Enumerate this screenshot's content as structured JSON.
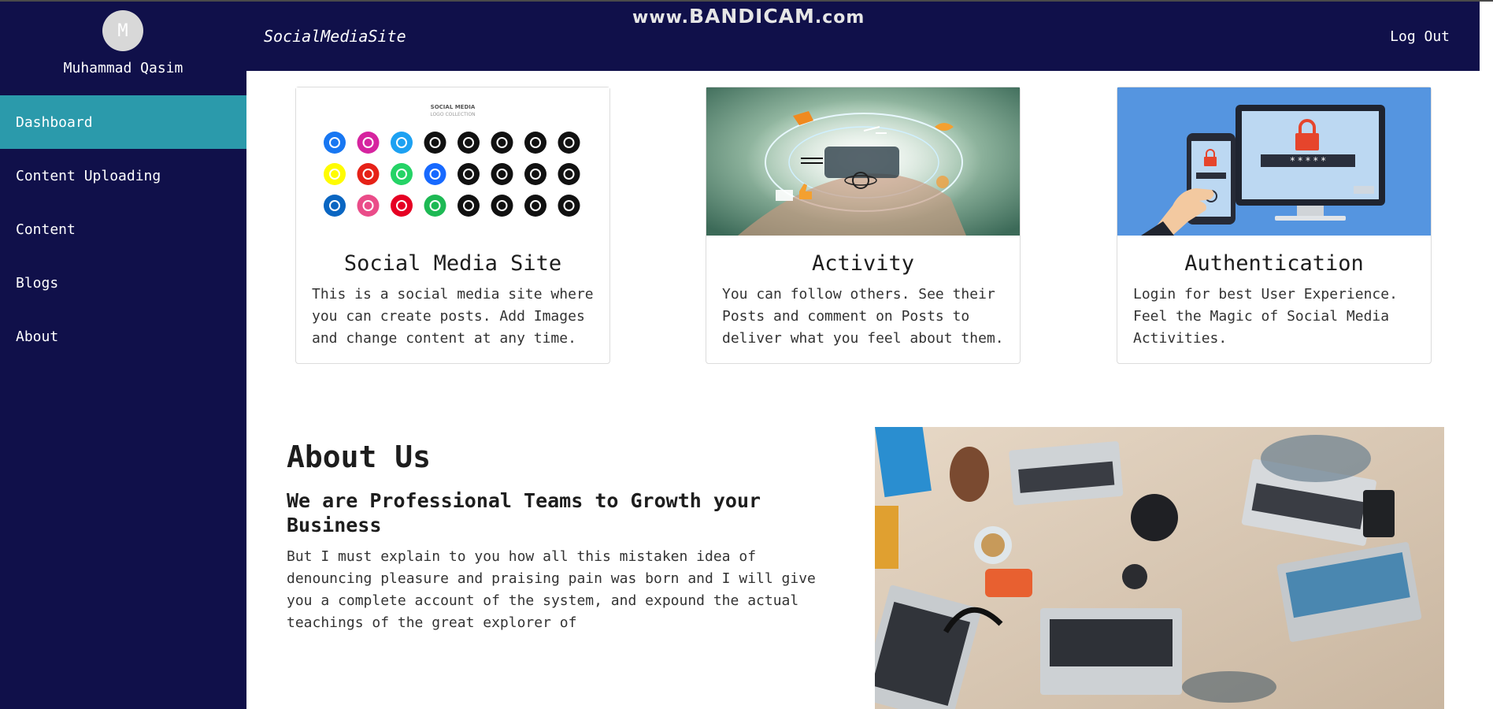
{
  "sidebar": {
    "avatar_initial": "M",
    "username": "Muhammad Qasim",
    "items": [
      {
        "label": "Dashboard",
        "active": true
      },
      {
        "label": "Content Uploading"
      },
      {
        "label": "Content"
      },
      {
        "label": "Blogs"
      },
      {
        "label": "About"
      }
    ]
  },
  "header": {
    "brand": "SocialMediaSite",
    "logout": "Log Out",
    "watermark_prefix": "www.",
    "watermark_main": "BANDICAM",
    "watermark_suffix": ".com"
  },
  "cards": [
    {
      "title": "Social Media Site",
      "text": "This is a social media site where you can create posts. Add Images and change content at any time.",
      "logo_heading": "SOCIAL MEDIA",
      "logo_subheading": "LOGO COLLECTION"
    },
    {
      "title": "Activity",
      "text": "You can follow others. See their Posts and comment on Posts to deliver what you feel about them."
    },
    {
      "title": "Authentication",
      "text": "Login for best User Experience. Feel the Magic of Social Media Activities.",
      "password_mask": "* * * * *"
    }
  ],
  "about": {
    "title": "About Us",
    "subtitle": "We are Professional Teams to Growth your Business",
    "text": "But I must explain to you how all this mistaken idea of denouncing pleasure and praising pain was born and I will give you a complete account of the system, and expound the actual teachings of the great explorer of"
  },
  "colors": {
    "sidebar_bg": "#10104a",
    "active_item": "#2b9aab",
    "auth_bg": "#5595e0"
  }
}
